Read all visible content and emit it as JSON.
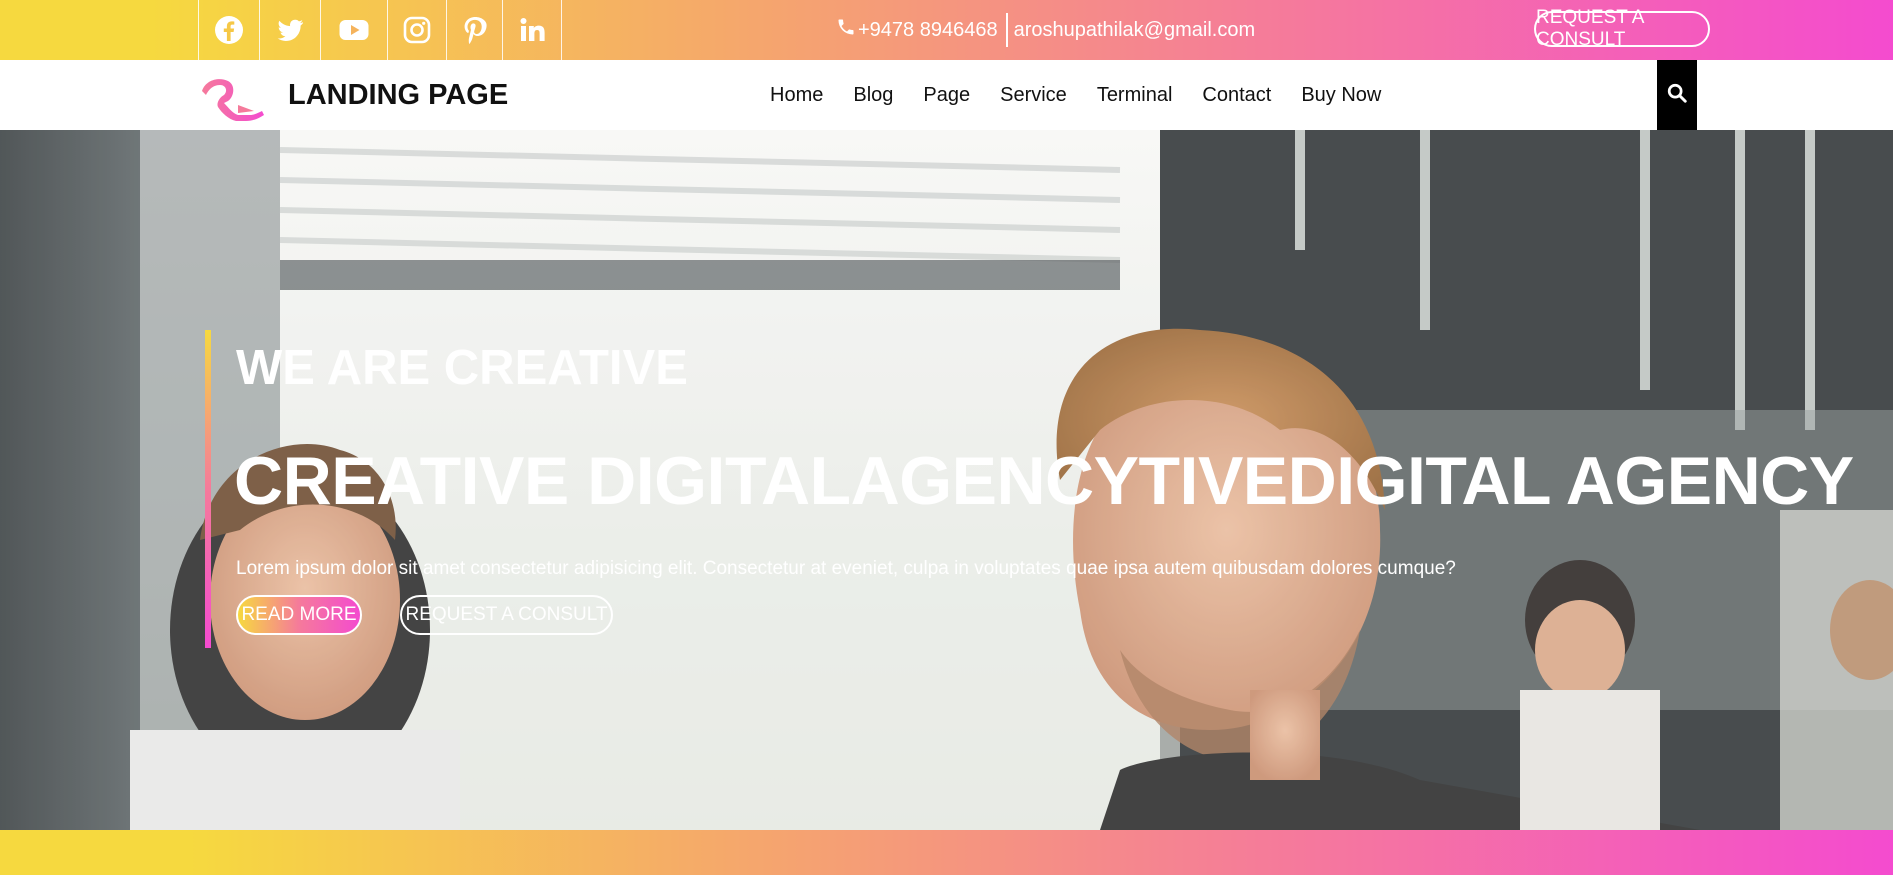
{
  "topbar": {
    "socials": [
      {
        "icon": "facebook-icon"
      },
      {
        "icon": "twitter-icon"
      },
      {
        "icon": "youtube-icon"
      },
      {
        "icon": "instagram-icon"
      },
      {
        "icon": "pinterest-icon"
      },
      {
        "icon": "linkedin-icon"
      }
    ],
    "phone_icon": "phone-icon",
    "phone": "+9478 8946468",
    "email": "aroshupathilak@gmail.com",
    "consult_label": "REQUEST A CONSULT"
  },
  "navbar": {
    "logo_icon": "brand-logo-icon",
    "brand": "LANDING PAGE",
    "menu": [
      {
        "label": "Home"
      },
      {
        "label": "Blog"
      },
      {
        "label": "Page"
      },
      {
        "label": "Service"
      },
      {
        "label": "Terminal"
      },
      {
        "label": "Contact"
      },
      {
        "label": "Buy Now"
      }
    ],
    "search_icon": "search-icon"
  },
  "hero": {
    "subtitle": "WE ARE CREATIVE",
    "title": "CREATIVE DIGITALAGENCYTIVEDIGITAL AGENCY",
    "description": "Lorem ipsum dolor sit amet consectetur adipisicing elit. Consectetur at eveniet, culpa in voluptates quae ipsa autem quibusdam dolores cumque?",
    "read_more_label": "READ MORE",
    "consult_label": "REQUEST A CONSULT"
  },
  "colors": {
    "gradient_start": "#f6d93f",
    "gradient_mid": "#f57a9b",
    "gradient_end": "#f44bcf",
    "nav_text": "#111111",
    "search_bg": "#000000"
  }
}
